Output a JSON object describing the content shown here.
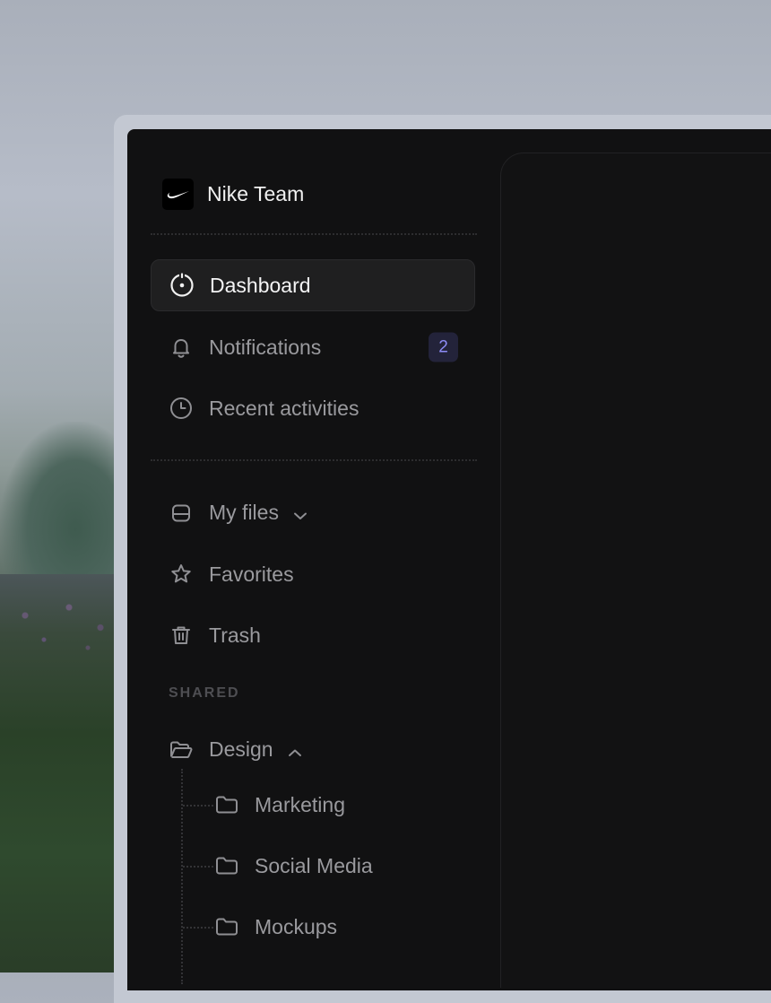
{
  "workspace": {
    "name": "Nike Team",
    "logo_icon": "nike-swoosh-icon"
  },
  "nav": {
    "primary": [
      {
        "label": "Dashboard",
        "icon": "dashboard-icon",
        "active": true
      },
      {
        "label": "Notifications",
        "icon": "bell-icon",
        "badge": "2"
      },
      {
        "label": "Recent activities",
        "icon": "clock-icon"
      }
    ],
    "secondary": [
      {
        "label": "My files",
        "icon": "drive-icon",
        "expand_icon": "chevron-down-icon"
      },
      {
        "label": "Favorites",
        "icon": "star-icon"
      },
      {
        "label": "Trash",
        "icon": "trash-icon"
      }
    ]
  },
  "shared": {
    "section_label": "SHARED",
    "folder": {
      "label": "Design",
      "icon": "folder-open-icon",
      "expand_icon": "chevron-up-icon"
    },
    "children": [
      {
        "label": "Marketing",
        "icon": "folder-icon"
      },
      {
        "label": "Social Media",
        "icon": "folder-icon"
      },
      {
        "label": "Mockups",
        "icon": "folder-icon"
      }
    ]
  },
  "colors": {
    "sidebar_bg": "#111112",
    "active_item_bg": "#1f1f20",
    "badge_bg": "#23233a",
    "badge_text": "#8d8cf6",
    "text_active": "#f4f4f5",
    "text_muted": "#9a9a9e"
  }
}
